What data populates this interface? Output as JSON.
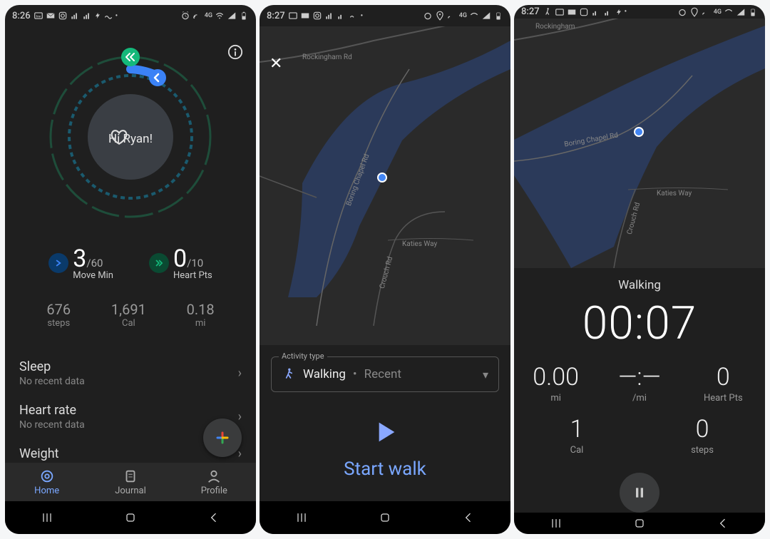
{
  "screen1": {
    "status_time": "8:26",
    "greeting": "Hi Ryan!",
    "move_min": {
      "value": "3",
      "total": "/60",
      "label": "Move Min"
    },
    "heart_pts": {
      "value": "0",
      "total": "/10",
      "label": "Heart Pts"
    },
    "stats": {
      "steps_val": "676",
      "steps_lbl": "steps",
      "cal_val": "1,691",
      "cal_lbl": "Cal",
      "mi_val": "0.18",
      "mi_lbl": "mi"
    },
    "list": {
      "sleep_title": "Sleep",
      "sleep_sub": "No recent data",
      "hr_title": "Heart rate",
      "hr_sub": "No recent data",
      "weight_title": "Weight"
    },
    "nav": {
      "home": "Home",
      "journal": "Journal",
      "profile": "Profile"
    }
  },
  "screen2": {
    "status_time": "8:27",
    "map_labels": {
      "rockingham": "Rockingham Rd",
      "boring": "Boring Chapel Rd",
      "crouch": "Crouch Rd",
      "katies": "Katies Way"
    },
    "activity": {
      "legend": "Activity type",
      "name": "Walking",
      "dot": " • ",
      "recent": "Recent"
    },
    "start_label": "Start walk"
  },
  "screen3": {
    "status_time": "8:27",
    "map_labels": {
      "rockingham": "Rockingham",
      "boring": "Boring Chapel Rd",
      "crouch": "Crouch Rd",
      "katies": "Katies Way"
    },
    "type": "Walking",
    "elapsed": "00:07",
    "dist_val": "0.00",
    "dist_lbl": "mi",
    "pace_val": "—:—",
    "pace_lbl": "/mi",
    "hp_val": "0",
    "hp_lbl": "Heart Pts",
    "cal_val": "1",
    "cal_lbl": "Cal",
    "steps_val": "0",
    "steps_lbl": "steps"
  }
}
